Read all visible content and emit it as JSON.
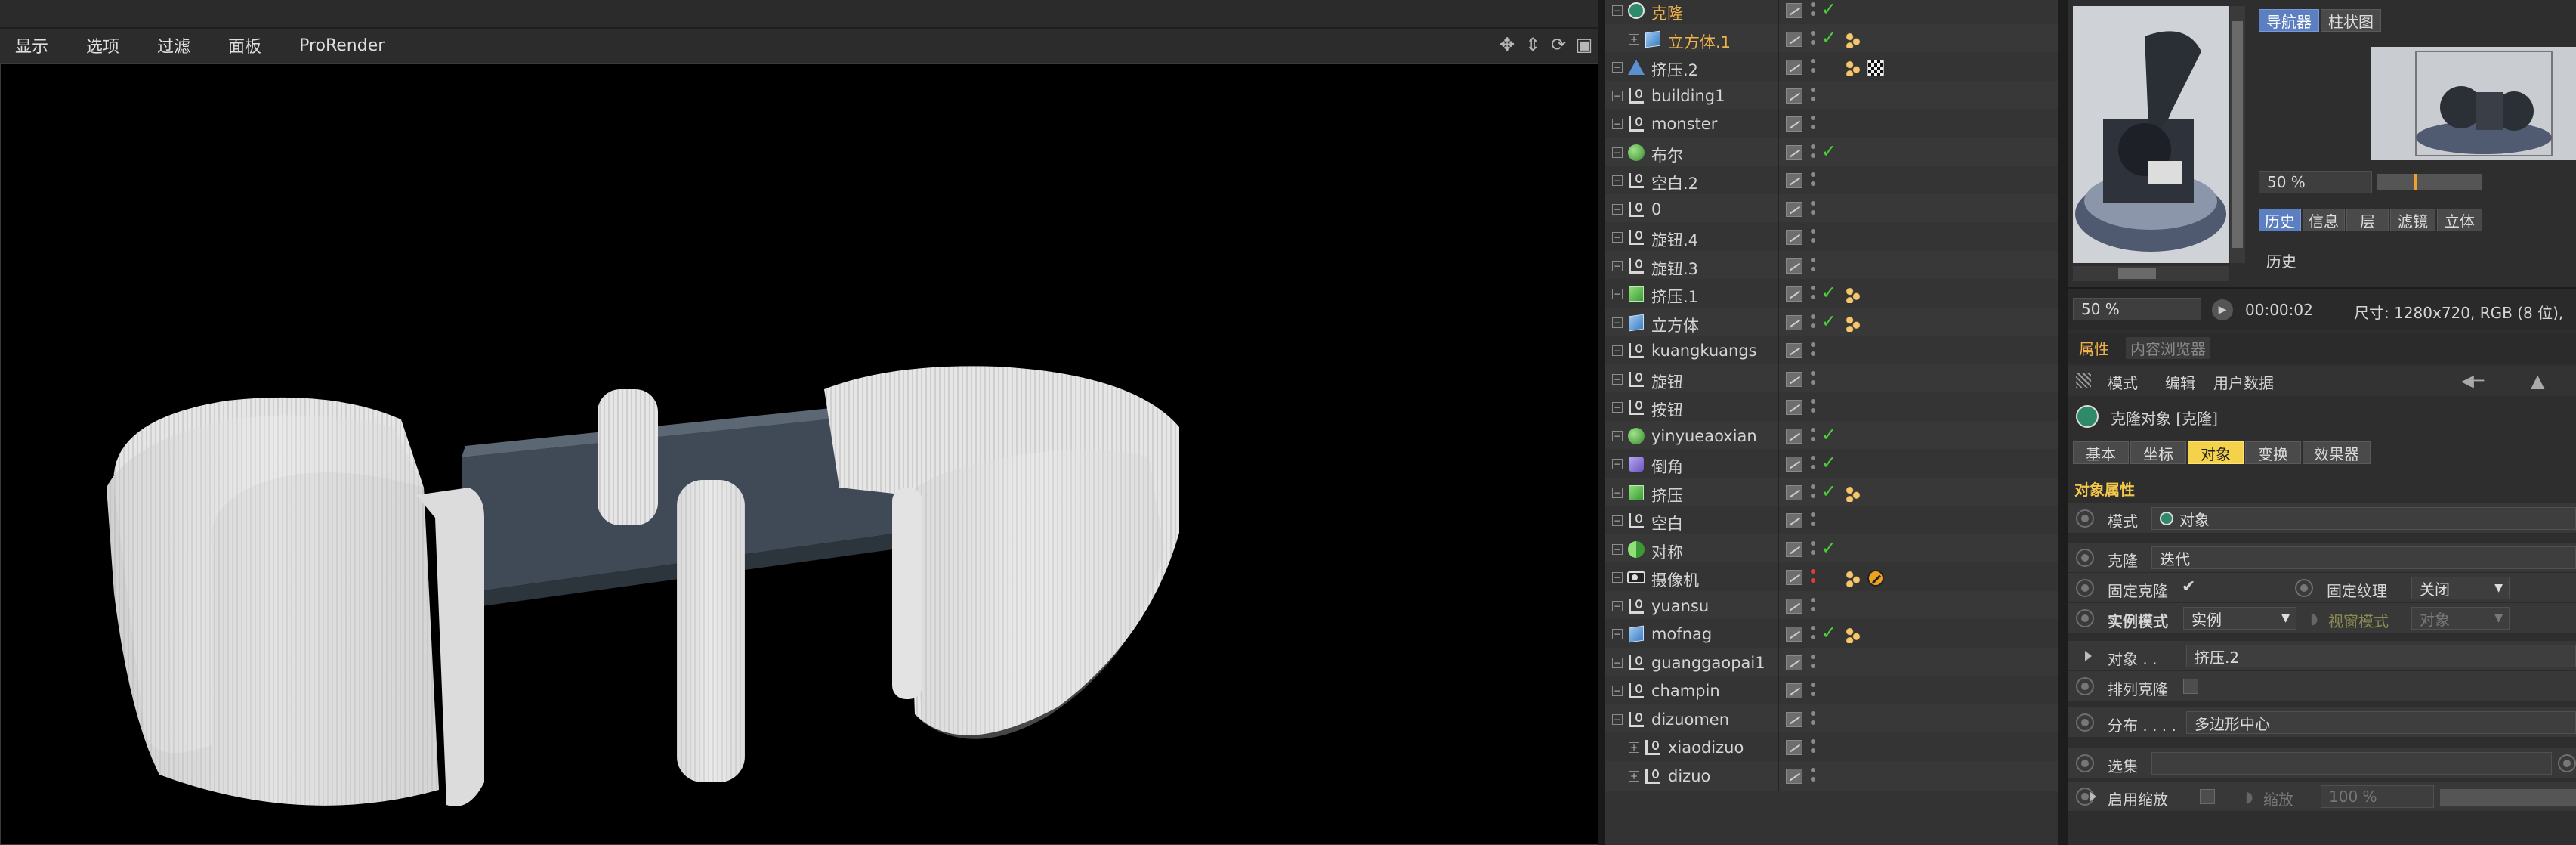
{
  "viewport": {
    "menu": [
      "显示",
      "选项",
      "过滤",
      "面板",
      "ProRender"
    ],
    "nav_icons": [
      "move-icon",
      "zoom-icon",
      "rotate-icon",
      "layout-icon"
    ]
  },
  "objects": [
    {
      "name": "克隆",
      "indent": 0,
      "icon": "cloner",
      "selected": true,
      "check": true,
      "tags": []
    },
    {
      "name": "立方体.1",
      "indent": 1,
      "icon": "cube",
      "selected": true,
      "check": true,
      "tags": [
        "phong"
      ]
    },
    {
      "name": "挤压.2",
      "indent": 0,
      "icon": "extrude",
      "selected": false,
      "check": false,
      "tags": [
        "phong",
        "checker"
      ]
    },
    {
      "name": "building1",
      "indent": 0,
      "icon": "null",
      "selected": false,
      "check": false,
      "tags": []
    },
    {
      "name": "monster",
      "indent": 0,
      "icon": "null",
      "selected": false,
      "check": false,
      "tags": []
    },
    {
      "name": "布尔",
      "indent": 0,
      "icon": "boole",
      "selected": false,
      "check": true,
      "tags": []
    },
    {
      "name": "空白.2",
      "indent": 0,
      "icon": "null",
      "selected": false,
      "check": false,
      "tags": []
    },
    {
      "name": "0",
      "indent": 0,
      "icon": "null",
      "selected": false,
      "check": false,
      "tags": []
    },
    {
      "name": "旋钮.4",
      "indent": 0,
      "icon": "null",
      "selected": false,
      "check": false,
      "tags": []
    },
    {
      "name": "旋钮.3",
      "indent": 0,
      "icon": "null",
      "selected": false,
      "check": false,
      "tags": []
    },
    {
      "name": "挤压.1",
      "indent": 0,
      "icon": "extrude-green",
      "selected": false,
      "check": true,
      "tags": [
        "phong"
      ]
    },
    {
      "name": "立方体",
      "indent": 0,
      "icon": "cube",
      "selected": false,
      "check": true,
      "tags": [
        "phong"
      ]
    },
    {
      "name": "kuangkuangs",
      "indent": 0,
      "icon": "null",
      "selected": false,
      "check": false,
      "tags": []
    },
    {
      "name": "旋钮",
      "indent": 0,
      "icon": "null",
      "selected": false,
      "check": false,
      "tags": []
    },
    {
      "name": "按钮",
      "indent": 0,
      "icon": "null",
      "selected": false,
      "check": false,
      "tags": []
    },
    {
      "name": "yinyueaoxian",
      "indent": 0,
      "icon": "boole",
      "selected": false,
      "check": true,
      "tags": []
    },
    {
      "name": "倒角",
      "indent": 0,
      "icon": "bevel",
      "selected": false,
      "check": true,
      "tags": []
    },
    {
      "name": "挤压",
      "indent": 0,
      "icon": "extrude-green",
      "selected": false,
      "check": true,
      "tags": [
        "phong"
      ]
    },
    {
      "name": "空白",
      "indent": 0,
      "icon": "null",
      "selected": false,
      "check": false,
      "tags": []
    },
    {
      "name": "对称",
      "indent": 0,
      "icon": "symmetry",
      "selected": false,
      "check": true,
      "tags": []
    },
    {
      "name": "摄像机",
      "indent": 0,
      "icon": "camera",
      "selected": false,
      "check": false,
      "tags": [
        "target",
        "stop"
      ]
    },
    {
      "name": "yuansu",
      "indent": 0,
      "icon": "null",
      "selected": false,
      "check": false,
      "tags": []
    },
    {
      "name": "mofnag",
      "indent": 0,
      "icon": "cube",
      "selected": false,
      "check": true,
      "tags": [
        "phong"
      ]
    },
    {
      "name": "guanggaopai1",
      "indent": 0,
      "icon": "null",
      "selected": false,
      "check": false,
      "tags": []
    },
    {
      "name": "champin",
      "indent": 0,
      "icon": "null",
      "selected": false,
      "check": false,
      "tags": []
    },
    {
      "name": "dizuomen",
      "indent": 0,
      "icon": "null",
      "selected": false,
      "check": false,
      "tags": []
    },
    {
      "name": "xiaodizuo",
      "indent": 1,
      "icon": "null",
      "selected": false,
      "check": false,
      "tags": []
    },
    {
      "name": "dizuo",
      "indent": 1,
      "icon": "null",
      "selected": false,
      "check": false,
      "tags": []
    }
  ],
  "navigator": {
    "tabs": [
      "导航器",
      "柱状图"
    ],
    "zoom": "50 %",
    "info_tabs": [
      "历史",
      "信息",
      "层",
      "滤镜",
      "立体"
    ],
    "history_label": "历史"
  },
  "render_status": {
    "zoom": "50 %",
    "time": "00:00:02",
    "size": "尺寸: 1280x720, RGB (8 位),"
  },
  "attributes": {
    "tabs": [
      "属性",
      "内容浏览器"
    ],
    "menu": [
      "模式",
      "编辑",
      "用户数据"
    ],
    "object_title": "克隆对象 [克隆]",
    "subtabs": [
      "基本",
      "坐标",
      "对象",
      "变换",
      "效果器"
    ],
    "section": "对象属性",
    "mode_label": "模式",
    "mode_value": "对象",
    "clone_label": "克隆",
    "clone_value": "迭代",
    "fixed_clone_label": "固定克隆",
    "fixed_clone_checked": "✔",
    "fixed_texture_label": "固定纹理",
    "fixed_texture_value": "关闭",
    "instance_mode_label": "实例模式",
    "instance_mode_value": "实例",
    "viewport_mode_label": "视窗模式",
    "viewport_mode_value": "对象",
    "object_label": "对象 . .",
    "object_value": "挤压.2",
    "sort_clones_label": "排列克隆",
    "distribution_label": "分布 . . . .",
    "distribution_value": "多边形中心",
    "selection_label": "选集",
    "enable_scale_label": "启用缩放",
    "scale_label": "缩放",
    "scale_value": "100 %"
  },
  "colors": {
    "accent_blue": "#5b7fc0",
    "selected_orange": "#f0b24b",
    "active_yellow": "#f4d24a",
    "check_green": "#4ccf3a"
  }
}
